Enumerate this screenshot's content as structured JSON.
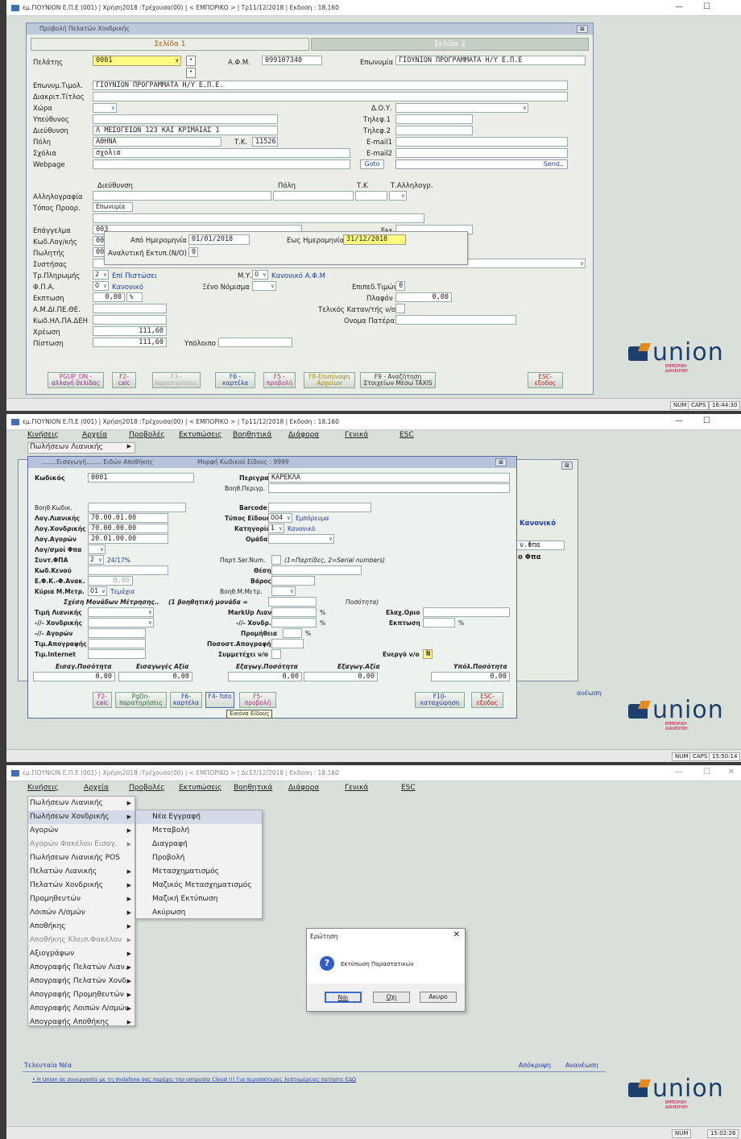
{
  "s1": {
    "title": "εμ.ΓΙΟΥΝΙΟΝ Ε.Π.Ε (001) | Χρήση2018 :Τρέχουσα(00) | < ΕΜΠΟΡΙΚΟ > | Τρ11/12/2018 | Εκδοση : 18.160",
    "form_title": "Προβολή Πελατών Χονδρικής",
    "tab1": "Σελίδα 1",
    "tab2": "Σελίδα 2",
    "labels": {
      "customer": "Πελάτης",
      "afm": "Α.Φ.Μ.",
      "name": "Επωνυμία",
      "tradename": "Επωνυμ.Τιμολ.",
      "disc_title": "Διακριτ.Τίτλος",
      "country": "Χώρα",
      "responsible": "Υπεύθυνος",
      "address": "Διεύθυνση",
      "city": "Πόλη",
      "comments": "Σχόλια",
      "webpage": "Webpage",
      "doy": "Δ.Ο.Υ.",
      "tel1": "Τηλεφ.1",
      "tel2": "Τηλεφ.2",
      "email1": "E-mail1",
      "email2": "E-mail2",
      "tk": "Τ.Κ.",
      "corr": "Αλληλογραφία",
      "delivery": "Τόπος Προορ.",
      "col_addr": "Διεύθυνση",
      "col_city": "Πόλη",
      "col_tk": "Τ.Κ",
      "col_corr": "Τ.Αλληλογρ.",
      "profession": "Επάγγελμα",
      "acc_code": "Κωδ.Λογ/κής",
      "salesman": "Πωλητής",
      "system": "Συστήσας",
      "payment": "Τρ.Πληρωμής",
      "fpa": "Φ.Π.Α.",
      "discount": "Εκπτωση",
      "amdipethe": "Α.Μ.ΔΙ.ΠΕ.ΘΕ.",
      "kwd_dei": "Κωδ.ΗΛ.ΠΑ.ΔΕΗ",
      "debit": "Χρέωση",
      "credit": "Πίστωση",
      "balance": "Υπόλοιπο",
      "myf": "Μ.Υ.Φ.",
      "currency": "Ξένο Νόμισμα",
      "price_level": "Επιπεδ.Τιμών",
      "plafond": "Πλαφόν",
      "final_consumer": "Τελικός Καταν/τής ν/ο",
      "father": "Ονομα Πατέρα",
      "fax": "Fax",
      "pct": "%"
    },
    "values": {
      "customer": "0001",
      "afm": "099107340",
      "name": "ΓΙΟΥΝΙΟΝ ΠΡΟΓΡΑΜΜΑΤΑ Η/Υ Ε.Π.Ε",
      "tradename": "ΓΙΟΥΝΙΟΝ ΠΡΟΓΡΑΜΜΑΤΑ Η/Υ Ε.Π.Ε.",
      "address": "Λ ΜΕΣΟΓΕΙΩΝ 123 ΚΑΙ ΚΡΙΜΑΙΑΣ 1",
      "city": "ΑΘΗΝΑ",
      "tk": "11526",
      "comments": "σχολια",
      "delivery": "Επωνυμία",
      "prof_code": "003",
      "acc_code": "00",
      "salesman": "00",
      "payment_code": "2",
      "payment": "Επί Πιστώσει",
      "fpa_code": "0",
      "fpa": "Κανονικό",
      "myf_code": "0",
      "myf": "Κανονικό Α.Φ.Μ",
      "price_level": "0",
      "plafond": "0,00",
      "discount": "0,00",
      "debit": "111,60",
      "credit": "111,60"
    },
    "goto": "Goto",
    "send": "Send..",
    "popup": {
      "from_label": "Από Ημερομηνία",
      "from": "01/01/2018",
      "to_label": "Εως Ημερομηνία",
      "to": "31/12/2018",
      "analytic_label": "Αναλυτική Εκτυπ.(N/O)",
      "analytic": "0"
    },
    "fkeys": [
      {
        "k": "PGUP_DN -",
        "t": "αλλαγή σελίδας"
      },
      {
        "k": "F2-",
        "t": "calc"
      },
      {
        "k": "F3 -",
        "t": "παρατηρήσεις"
      },
      {
        "k": "F6 -",
        "t": "καρτέλα"
      },
      {
        "k": "F5 -",
        "t": "προβολή"
      },
      {
        "k": "F8-Επισύναψη",
        "t": "Αρχείων"
      },
      {
        "k": "F9 - Αναζήτηση",
        "t": "Στοιχείων Μέσω TAXIS"
      },
      {
        "k": "ESC-",
        "t": "εξοδος"
      }
    ],
    "status": {
      "num": "NUM",
      "caps": "CAPS",
      "time": "16:44:30"
    }
  },
  "s2": {
    "title": "εμ.ΓΙΟΥΝΙΟΝ Ε.Π.Ε (001) | Χρήση2018 :Τρέχουσα(00) | < ΕΜΠΟΡΙΚΟ > | Τρ11/12/2018 | Εκδοση : 18.160",
    "menu": [
      "Κινήσεις",
      "Αρχεία",
      "Προβολές",
      "Εκτυπώσεις",
      "Βοηθητικά",
      "Διάφορα",
      "Γενικά",
      "ESC"
    ],
    "submenu": "Πωλήσεων Λιανικής",
    "win_title": "........Εισαγωγή........ Ειδών Αποθήκης",
    "code_format": "Μορφή Κωδικού Είδους : 9999",
    "labels": {
      "code": "Κωδικός",
      "descr": "Περιγραφή",
      "aux_descr": "Βοηθ.Περιγρ.",
      "aux_code": "Βοηθ.Κωδικ.",
      "barcode": "Barcode",
      "acc_retail": "Λογ.Λιανικής",
      "acc_wholesale": "Λογ.Χονδρικής",
      "acc_purchase": "Λογ.Αγορών",
      "acc_vat": "Λογ/σμοί Φπα",
      "type": "Τύπος Είδους",
      "category": "Κατηγορία",
      "group": "Ομάδα",
      "vat": "Συντ.ΦΠΑ",
      "serial": "Παρτ.Ser.Num.",
      "serial_hint": "(1=Παρτίδες, 2=Serial numbers)",
      "empty_code": "Κωδ.Κενού",
      "position": "Θέση",
      "efk": "Ε.Φ.Κ.-Φ.Ανακ.",
      "weight": "Βάρος",
      "unit": "Κύρια Μ.Μετρ.",
      "aux_unit": "Βοηθ.Μ.Μετρ.",
      "relation": "Σχέση Μονάδων Μέτρησης..",
      "relation2": "(1 βοηθητική μονάδα =",
      "quantity": "Ποσότητα)",
      "price_retail": "Τιμή Λιανικής",
      "price_wholesale": "-//- Χονδρικής",
      "price_purchase": "-//- Αγορών",
      "price_inventory": "Τιμ.Απογραφής",
      "price_internet": "Τιμ.Internet",
      "markup_retail": "MarkUp Λιαν.",
      "markup_wholesale": "-//- Χονδρ.",
      "commission": "Προμήθεια",
      "inv_pct": "Ποσοστ.Απογραφής",
      "participation": "Συμμετέχει ν/ο",
      "min_limit": "Ελαχ.Οριο",
      "discount": "Εκπτωση",
      "active": "Ενεργό ν/ο",
      "pct": "%",
      "in_qty": "Εισαγ.Ποσότητα",
      "in_value": "Εισαγωγές Αξία",
      "out_qty": "Εξαγωγ.Ποσότητα",
      "out_value": "Εξαγωγ.Αξία",
      "remain_qty": "Υπόλ.Ποσότητα"
    },
    "values": {
      "code": "0001",
      "descr": "ΚΑΡΕΚΛΑ",
      "acc_retail": "70.00.01.00",
      "acc_wholesale": "70.00.00.00",
      "acc_purchase": "20.01.00.00",
      "type_code": "004",
      "type": "Εμπόρευμα",
      "category_code": "1",
      "category": "Κανονικό",
      "vat_code": "2",
      "vat": "24/17%",
      "efk": "0,00",
      "unit_code": "01",
      "unit": "Τεμάχια",
      "active": "N",
      "in_qty": "0,00",
      "in_value": "0,00",
      "out_qty": "0,00",
      "out_value": "0,00",
      "remain_qty": "0,00"
    },
    "bg": {
      "normal": "Κανονικό",
      "fpa1": "ν.Φπα",
      "fpa2": "ο Φπα",
      "renew": "ανέωση"
    },
    "fkeys": [
      {
        "k": "F2-",
        "t": "calc"
      },
      {
        "k": "PgDn-",
        "t": "παρατηρήσεις"
      },
      {
        "k": "F6-",
        "t": "καρτέλα"
      },
      {
        "k": "F4- foto",
        "t": ""
      },
      {
        "k": "F5-",
        "t": "προβολή"
      },
      {
        "k": "F10-",
        "t": "καταχώρηση"
      },
      {
        "k": "ESC-",
        "t": "εξοδος"
      }
    ],
    "tooltip": "Εικόνα Είδους",
    "status": {
      "num": "NUM",
      "caps": "CAPS",
      "time": "15:50:14"
    }
  },
  "s3": {
    "title": "εμ.ΓΙΟΥΝΙΟΝ Ε.Π.Ε (001) | Χρήση2018 :Τρέχουσα(00) | < ΕΜΠΟΡΙΚΟ > | Δε17/12/2018 | Εκδοση : 18.160",
    "menu": [
      "Κινήσεις",
      "Αρχεία",
      "Προβολές",
      "Εκτυπώσεις",
      "Βοηθητικά",
      "Διάφορα",
      "Γενικά",
      "ESC"
    ],
    "items": [
      "Πωλήσεων Λιανικής",
      "Πωλήσεων Χονδρικής",
      "Αγορών",
      "Αγορών Φακέλου Εισαγ.",
      "Πωλήσεων Λιανικής POS",
      "Πελατών Λιανικής",
      "Πελατών Χονδρικής",
      "Προμηθευτών",
      "Λοιπών Λ/σμών",
      "Αποθήκης",
      "Αποθήκης Κλεισ.Φακέλου",
      "Αξιογράφων",
      "Απογραφής Πελατών Λιαν.",
      "Απογραφής Πελατών Χονδ.",
      "Απογραφής Προμηθευτών",
      "Απογραφής Λοιπών Λ/σμών",
      "Απογραφής Αποθήκης"
    ],
    "sub": [
      "Νέα Εγγραφή",
      "Μεταβολή",
      "Διαγραφή",
      "Προβολή",
      "Μετασχηματισμός",
      "Μαζικός Μετασχηματισμός",
      "Μαζική Εκτύπωση",
      "Ακύρωση"
    ],
    "dialog": {
      "title": "Ερώτηση",
      "message": "Εκτύπωση Παραστατικών",
      "yes": "Ναι",
      "no": "Οχι",
      "cancel": "Ακυρο"
    },
    "news_label": "Τελευταία Νέα",
    "news": "• Η Union σε συνεργασία με τη Vodafone σας παρέχει την υπηρεσία Cloud !!! Για περισσότερες λεπτομέρειες πατήστε ΕΔΩ",
    "hide": "Απόκρυψη",
    "refresh": "Ανανέωση",
    "status": {
      "num": "NUM",
      "time": "15:02:26"
    }
  },
  "logo": {
    "text": "union",
    "sub1": "ΕΜΠΟΡΙΚΗ",
    "sub2": "ΔΙΑΧΕΙΡΙΣΗ"
  }
}
